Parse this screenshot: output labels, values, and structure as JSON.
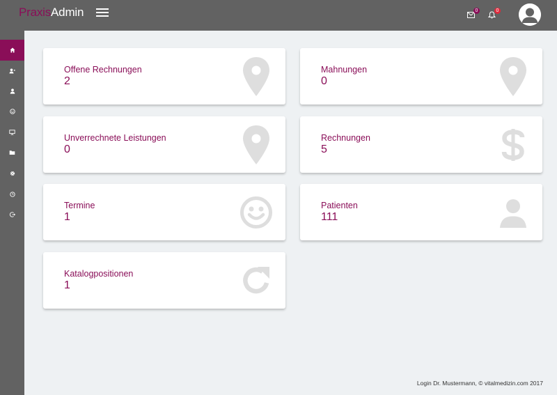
{
  "app": {
    "logo_part1": "Praxis",
    "logo_part2": "Admin"
  },
  "header": {
    "messages_count": "0",
    "notifications_count": "0"
  },
  "sidebar": {
    "items": [
      {
        "icon": "home-icon",
        "active": true
      },
      {
        "icon": "user-add-icon"
      },
      {
        "icon": "user-icon"
      },
      {
        "icon": "smiley-icon"
      },
      {
        "icon": "monitor-icon"
      },
      {
        "icon": "folder-icon"
      },
      {
        "icon": "gear-icon"
      },
      {
        "icon": "clock-icon"
      },
      {
        "icon": "logout-icon"
      }
    ]
  },
  "cards": [
    {
      "label": "Offene Rechnungen",
      "value": "2",
      "icon": "map-marker-icon"
    },
    {
      "label": "Mahnungen",
      "value": "0",
      "icon": "map-marker-icon"
    },
    {
      "label": "Unverrechnete Leistungen",
      "value": "0",
      "icon": "map-marker-icon"
    },
    {
      "label": "Rechnungen",
      "value": "5",
      "icon": "dollar-icon"
    },
    {
      "label": "Termine",
      "value": "1",
      "icon": "smiley-icon"
    },
    {
      "label": "Patienten",
      "value": "111",
      "icon": "user-icon"
    },
    {
      "label": "Katalogpositionen",
      "value": "1",
      "icon": "refresh-icon"
    }
  ],
  "footer": {
    "text": "Login Dr. Mustermann, © vitalmedizin.com 2017"
  },
  "colors": {
    "accent": "#8a0e58",
    "topbar": "#626262",
    "background": "#eef1f3",
    "icon_gray": "#dedede"
  }
}
